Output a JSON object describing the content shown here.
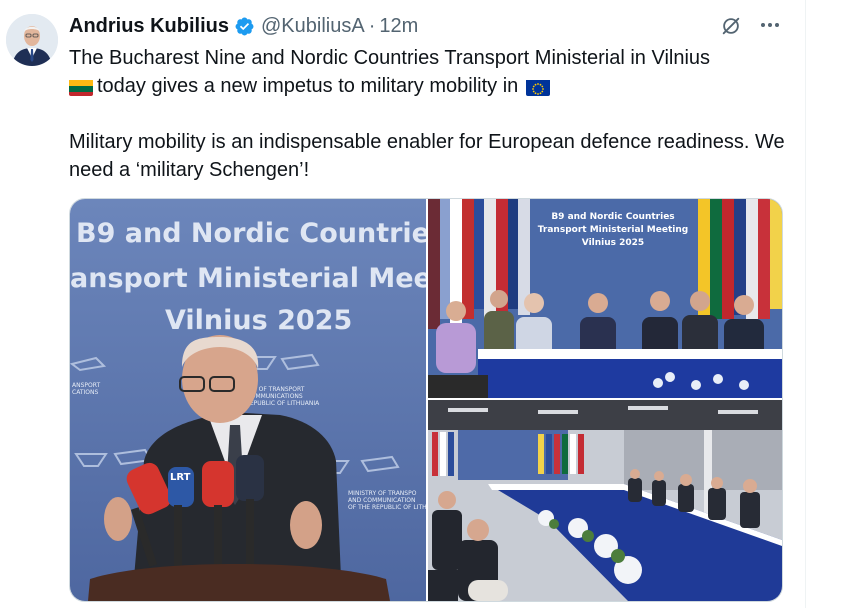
{
  "tweet": {
    "author_name": "Andrius Kubilius",
    "handle": "@KubiliusA",
    "separator": "·",
    "time": "12m",
    "paragraph1_a": "The Bucharest Nine and Nordic Countries Transport Ministerial in Vilnius",
    "paragraph1_b": "today gives a new impetus to military mobility in",
    "paragraph2": "Military mobility is an indispensable enabler for European defence readiness. We need a ‘military Schengen’!",
    "flag_1": "lithuania-flag",
    "flag_2": "eu-flag"
  },
  "icons": {
    "verified": "verified-badge-icon",
    "grok": "grok-icon",
    "more": "more-icon"
  },
  "photos": {
    "main_backdrop_line1": "B9 and Nordic Countrie",
    "main_backdrop_line2": "ansport Ministerial Mee",
    "main_backdrop_line3": "Vilnius 2025",
    "main_side_left": "ANSPORT\nCATIONS",
    "main_side_mid": "ISTRY OF TRANSPORT\nD COMMUNICATIONS\nE REPUBLIC OF LITHUANIA",
    "main_side_right": "MINISTRY OF TRANSPO\nAND COMMUNICATION\nOF THE REPUBLIC OF LITHUANIA",
    "mic_label": "LRT",
    "tr_backdrop_line1": "B9 and Nordic Countries",
    "tr_backdrop_line2": "Transport Ministerial Meeting",
    "tr_backdrop_line3": "Vilnius 2025"
  },
  "colors": {
    "text": "#0f1419",
    "secondary": "#536471",
    "verified_blue": "#1d9bf0",
    "backdrop_blue": "#5570a8",
    "border": "#cfd9de"
  }
}
